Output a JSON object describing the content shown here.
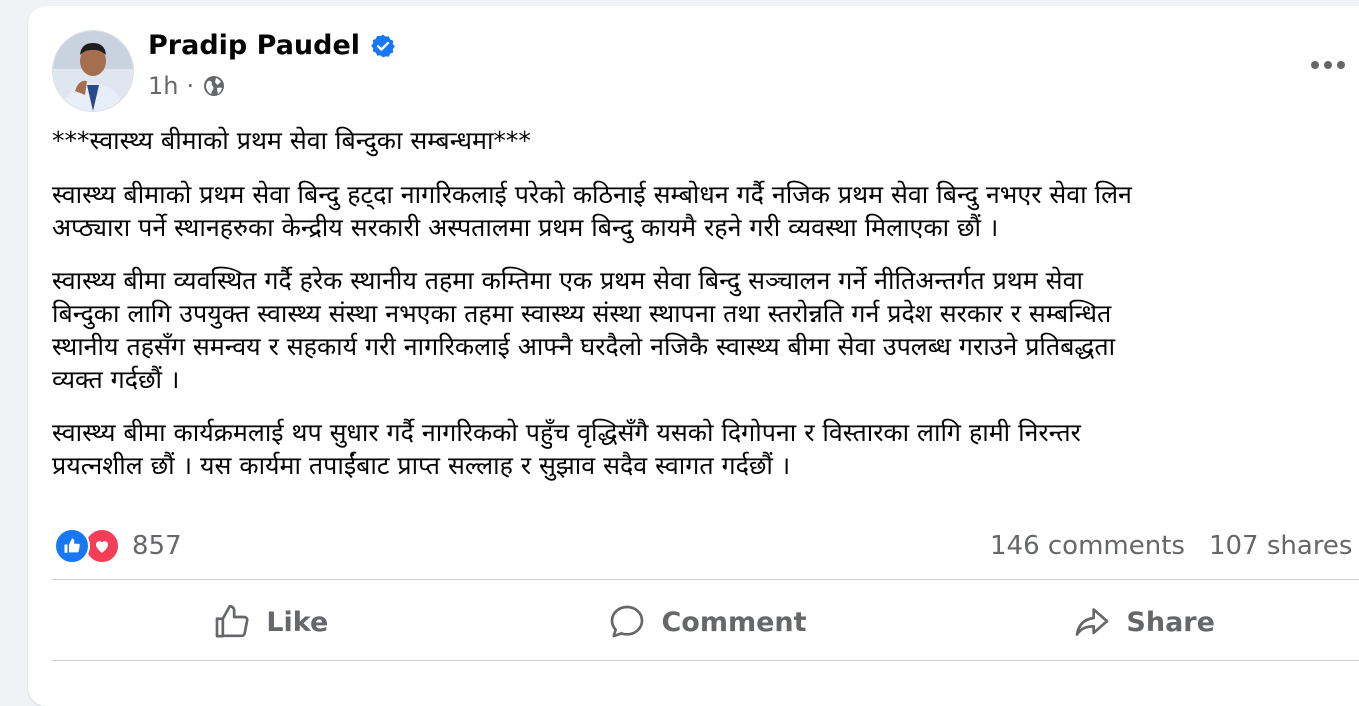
{
  "post": {
    "author": "Pradip Paudel",
    "time": "1h",
    "separator": "·",
    "title": "***स्वास्थ्य बीमाको प्रथम सेवा बिन्दुका सम्बन्धमा***",
    "para1_line1": "स्वास्थ्य बीमाको प्रथम सेवा बिन्दु हट्दा नागरिकलाई परेको कठिनाई सम्बोधन गर्दै नजिक प्रथम सेवा बिन्दु नभएर सेवा लिन",
    "para1_line2": "अप्ठ्यारा पर्ने स्थानहरुका केन्द्रीय सरकारी अस्पतालमा प्रथम बिन्दु कायमै रहने गरी व्यवस्था मिलाएका छौं ।",
    "para2_line1": "स्वास्थ्य बीमा व्यवस्थित गर्दै हरेक स्थानीय तहमा कम्तिमा एक प्रथम सेवा बिन्दु सञ्चालन गर्ने नीतिअन्तर्गत प्रथम सेवा",
    "para2_line2": "बिन्दुका लागि उपयुक्त स्वास्थ्य संस्था नभएका तहमा स्वास्थ्य संस्था स्थापना तथा स्तरोन्नति गर्न प्रदेश सरकार र सम्बन्धित",
    "para2_line3": "स्थानीय तहसँग समन्वय र सहकार्य गरी नागरिकलाई आफ्नै घरदैलो नजिकै स्वास्थ्य बीमा सेवा उपलब्ध गराउने प्रतिबद्धता",
    "para2_line4": "व्यक्त गर्दछौं ।",
    "para3_line1": "स्वास्थ्य बीमा कार्यक्रमलाई थप सुधार गर्दै नागरिकको पहुँच वृद्धिसँगै यसको दिगोपना र विस्तारका लागि हामी निरन्तर",
    "para3_line2": "प्रयत्नशील छौं । यस कार्यमा तपाईंबाट प्राप्त सल्लाह र सुझाव सदैव स्वागत गर्दछौं ।"
  },
  "stats": {
    "reactions": "857",
    "comments": "146 comments",
    "shares": "107 shares"
  },
  "actions": {
    "like": "Like",
    "comment": "Comment",
    "share": "Share"
  },
  "icons": {
    "verified": "verified-badge-icon",
    "audience": "globe-icon",
    "more": "more-options-icon",
    "like_reaction": "thumbs-up-icon",
    "love_reaction": "heart-icon",
    "like_action": "thumbs-up-outline-icon",
    "comment_action": "speech-bubble-icon",
    "share_action": "share-arrow-icon"
  },
  "colors": {
    "brand_blue": "#1877f2",
    "love_red": "#f33e58",
    "secondary_text": "#65676b",
    "primary_text": "#050505"
  }
}
